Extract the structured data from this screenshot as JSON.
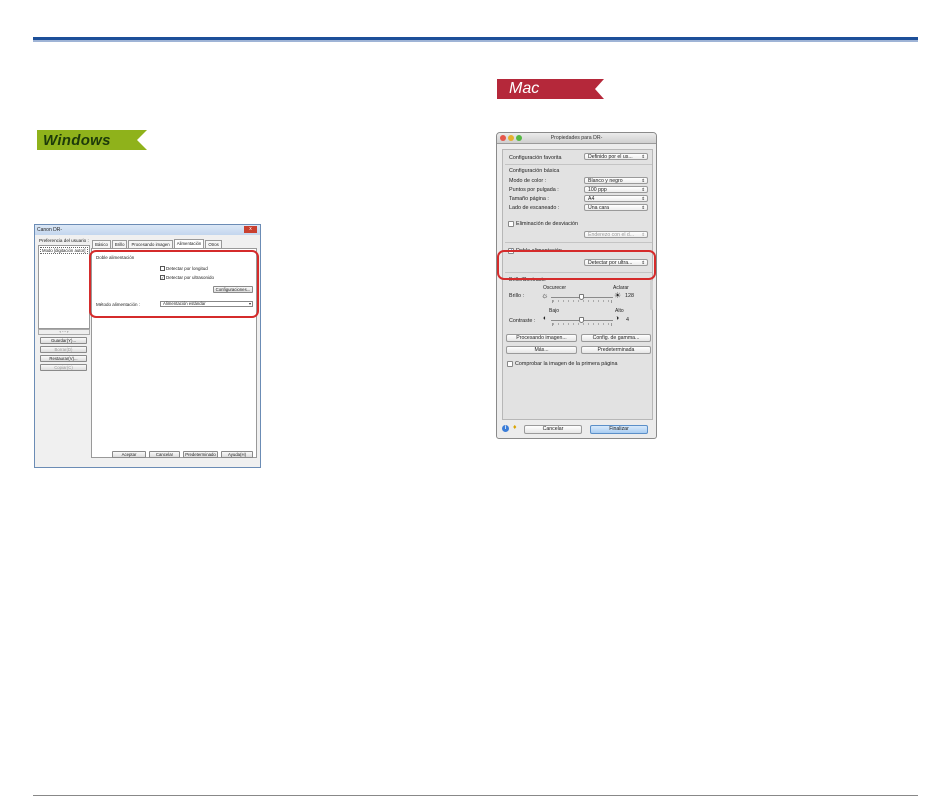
{
  "windows": {
    "badge": "Windows",
    "title": "Canon DR-",
    "close": "x",
    "pref_label": "Preferencia del usuario :",
    "list_item": "Modo [digitación autor]",
    "scroll": "‹  ···  ›",
    "side_buttons": {
      "save": "Guardar(Y)...",
      "delete": "Borrar(D)",
      "restore": "Restaurar(V)...",
      "copy": "Copiar(C)"
    },
    "tabs": [
      "Básico",
      "Brillo",
      "Procesando imagen",
      "Alimentación",
      "Otros"
    ],
    "active_tab": "Alimentación",
    "double_feed_label": "Doble alimentación",
    "check_length": "Detectar por longitud",
    "check_length_checked": false,
    "check_ultrasonic": "Detectar por ultrasonido",
    "check_ultrasonic_checked": true,
    "config_button": "Configuraciones...",
    "feed_method_label": "Método alimentación :",
    "feed_method_value": "Alimentación estándar",
    "bottom_buttons": {
      "accept": "Aceptar",
      "cancel": "Cancelar",
      "default": "Predeterminado",
      "help": "Ayuda(H)"
    },
    "highlight_color": "#d52b2b"
  },
  "mac": {
    "badge": "Mac",
    "title": "Propiedades para DR-",
    "fav_label": "Configuración favorita",
    "fav_value": "Definido por el us...",
    "basic_header": "Configuración básica",
    "rows": [
      {
        "label": "Modo de color :",
        "value": "Blanco y negro"
      },
      {
        "label": "Puntos por pulgada :",
        "value": "100 ppp"
      },
      {
        "label": "Tamaño página :",
        "value": "A4"
      },
      {
        "label": "Lado de escaneado :",
        "value": "Una cara"
      }
    ],
    "deskew_label": "Eliminación de desviación",
    "deskew_value": "Enderezo con el d...",
    "double_feed_label": "Doble alimentación",
    "double_feed_checked": true,
    "double_feed_value": "Detectar por ultra...",
    "brightness_header": "Brillo/Contraste",
    "darker": "Oscurecer",
    "lighter": "Aclarar",
    "brightness_label": "Brillo :",
    "brightness_value": "128",
    "brightness_level": 0.5,
    "low": "Bajo",
    "high": "Alto",
    "contrast_label": "Contraste :",
    "contrast_value": "4",
    "contrast_level": 0.5,
    "buttons": {
      "image_processing": "Procesando imagen...",
      "gamma": "Config. de gamma...",
      "more": "Más...",
      "default": "Predeterminada"
    },
    "check_first_page": "Comprobar la imagen de la primera página",
    "footer": {
      "cancel": "Cancelar",
      "finish": "Finalizar"
    },
    "highlight_color": "#d52b2b"
  }
}
